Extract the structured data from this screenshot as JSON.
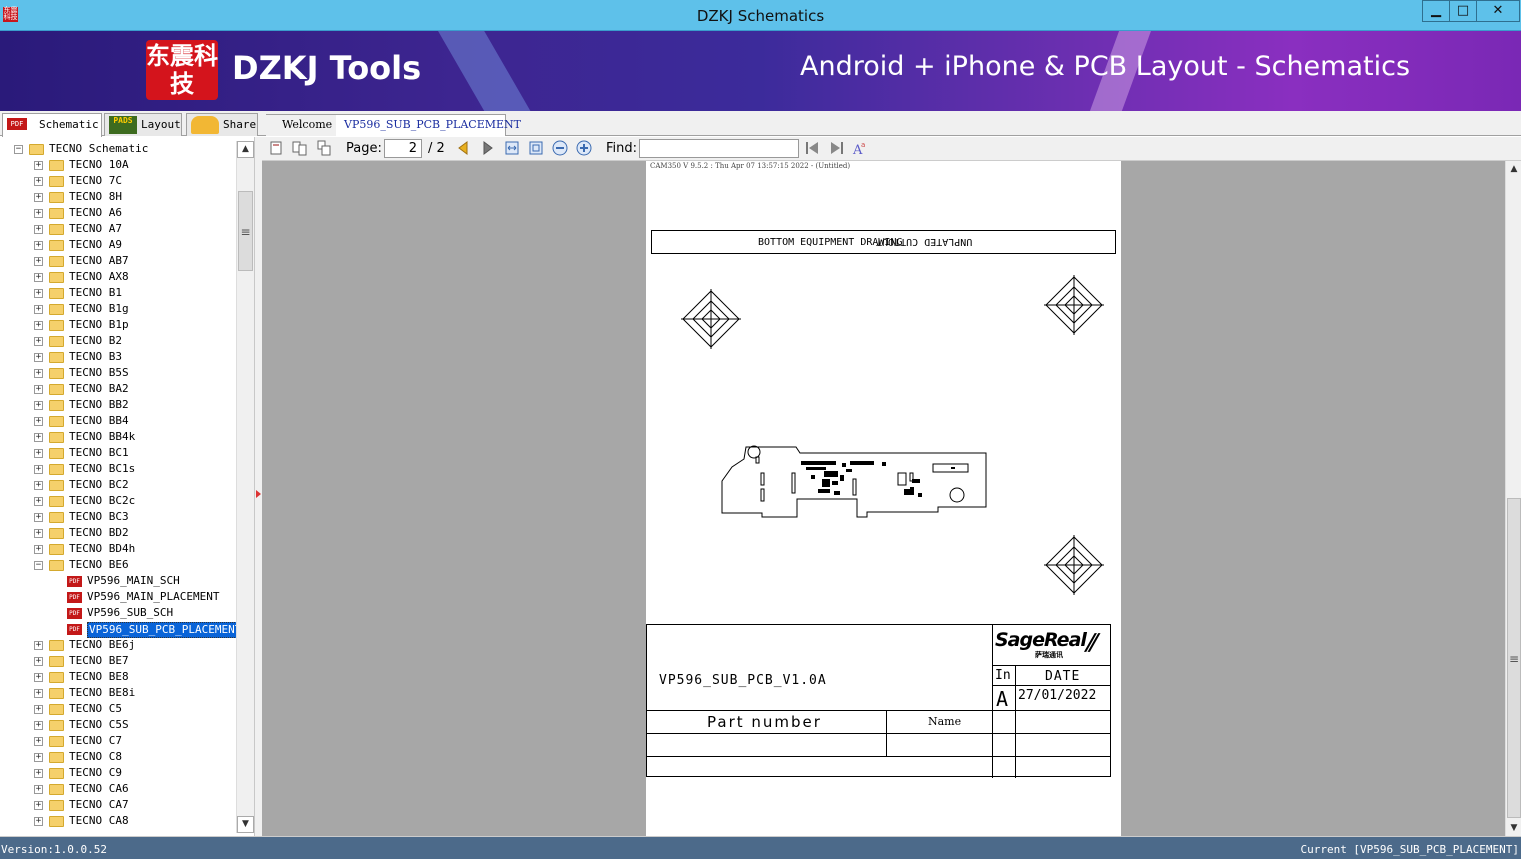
{
  "window": {
    "title": "DZKJ Schematics",
    "min_glyph": "▁",
    "max_glyph": "□",
    "close_glyph": "✕",
    "app_icon_text": "东震科技"
  },
  "banner": {
    "logo_text": "东震科技",
    "brand": "DZKJ Tools",
    "tagline": "Android + iPhone & PCB Layout - Schematics"
  },
  "left_tabs": [
    {
      "label": "Schematic",
      "icon": "pdf-icon",
      "badge": "PDF"
    },
    {
      "label": "Layout",
      "icon": "pads-icon",
      "badge": "PADS"
    },
    {
      "label": "Share",
      "icon": "share-icon"
    }
  ],
  "doc_tabs": [
    {
      "label": "Welcome"
    },
    {
      "label": "VP596_SUB_PCB_PLACEMENT"
    }
  ],
  "toolbar": {
    "page_label": "Page:",
    "page_current": "2",
    "page_total": "/ 2",
    "find_label": "Find:",
    "find_value": ""
  },
  "tree": {
    "root": "TECNO Schematic",
    "items": [
      "TECNO 10A",
      "TECNO 7C",
      "TECNO 8H",
      "TECNO A6",
      "TECNO A7",
      "TECNO A9",
      "TECNO AB7",
      "TECNO AX8",
      "TECNO B1",
      "TECNO B1g",
      "TECNO B1p",
      "TECNO B2",
      "TECNO B3",
      "TECNO B5S",
      "TECNO BA2",
      "TECNO BB2",
      "TECNO BB4",
      "TECNO BB4k",
      "TECNO BC1",
      "TECNO BC1s",
      "TECNO BC2",
      "TECNO BC2c",
      "TECNO BC3",
      "TECNO BD2",
      "TECNO BD4h",
      "TECNO BE6"
    ],
    "expanded_children": [
      "VP596_MAIN_SCH",
      "VP596_MAIN_PLACEMENT",
      "VP596_SUB_SCH",
      "VP596_SUB_PCB_PLACEMENT"
    ],
    "selected": "VP596_SUB_PCB_PLACEMENT",
    "items_after": [
      "TECNO BE6j",
      "TECNO BE7",
      "TECNO BE8",
      "TECNO BE8i",
      "TECNO C5",
      "TECNO C5S",
      "TECNO C7",
      "TECNO C8",
      "TECNO C9",
      "TECNO CA6",
      "TECNO CA7",
      "TECNO CA8"
    ]
  },
  "document": {
    "cam_line": "CAM350 V 9.5.2 : Thu Apr 07 13:57:15 2022 - (Untitled)",
    "header_text": "BOTTOM EQUIPMENT DRAWING",
    "header_mirror": "UNPLATED CUTTOUT",
    "doc_name": "VP596_SUB_PCB_V1.0A",
    "logo": "SageReal",
    "logo_sub": "萨瑞通讯",
    "col_in": "In",
    "col_date": "DATE",
    "rev": "A",
    "date": "27/01/2022",
    "part_number": "Part number",
    "name": "Name"
  },
  "status": {
    "version": "Version:1.0.0.52",
    "current": "Current [VP596_SUB_PCB_PLACEMENT]"
  }
}
